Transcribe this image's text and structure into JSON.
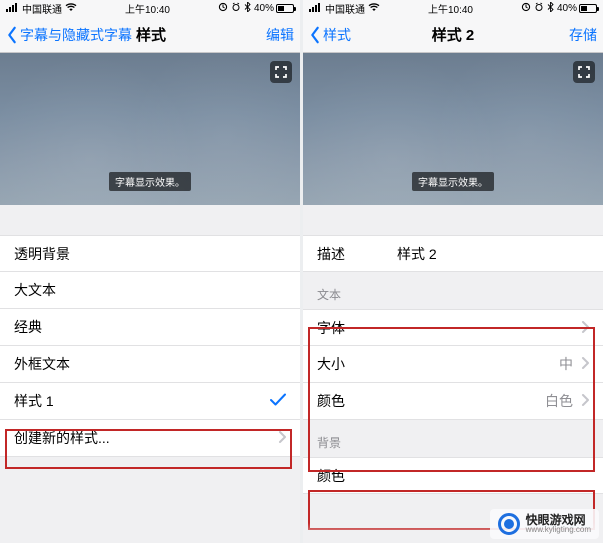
{
  "status": {
    "carrier": "中国联通",
    "time": "上午10:40",
    "battery_pct": "40%",
    "icons": {
      "signal": "signal-icon",
      "wifi": "wifi-icon",
      "orientation": "orientation-lock-icon",
      "alarm": "alarm-icon",
      "bt": "bluetooth-icon"
    }
  },
  "left": {
    "nav": {
      "back_label": "字幕与隐藏式字幕",
      "title": "样式",
      "action": "编辑"
    },
    "preview_caption": "字幕显示效果。",
    "styles": [
      "透明背景",
      "大文本",
      "经典",
      "外框文本",
      "样式 1"
    ],
    "selected_index": 4,
    "create_new": "创建新的样式..."
  },
  "right": {
    "nav": {
      "back_label": "样式",
      "title": "样式 2",
      "action": "存储"
    },
    "preview_caption": "字幕显示效果。",
    "describe_label": "描述",
    "describe_value": "样式 2",
    "sections": {
      "text": "文本",
      "background": "背景"
    },
    "rows": {
      "font": {
        "label": "字体",
        "value": ""
      },
      "size": {
        "label": "大小",
        "value": "中"
      },
      "color": {
        "label": "颜色",
        "value": "白色"
      },
      "bg_color": {
        "label": "颜色",
        "value": ""
      }
    }
  },
  "watermark": {
    "line1": "快眼游戏网",
    "line2": "www.kyligting.com"
  },
  "colors": {
    "ios_blue": "#0b74ff",
    "highlight": "#c22727"
  }
}
